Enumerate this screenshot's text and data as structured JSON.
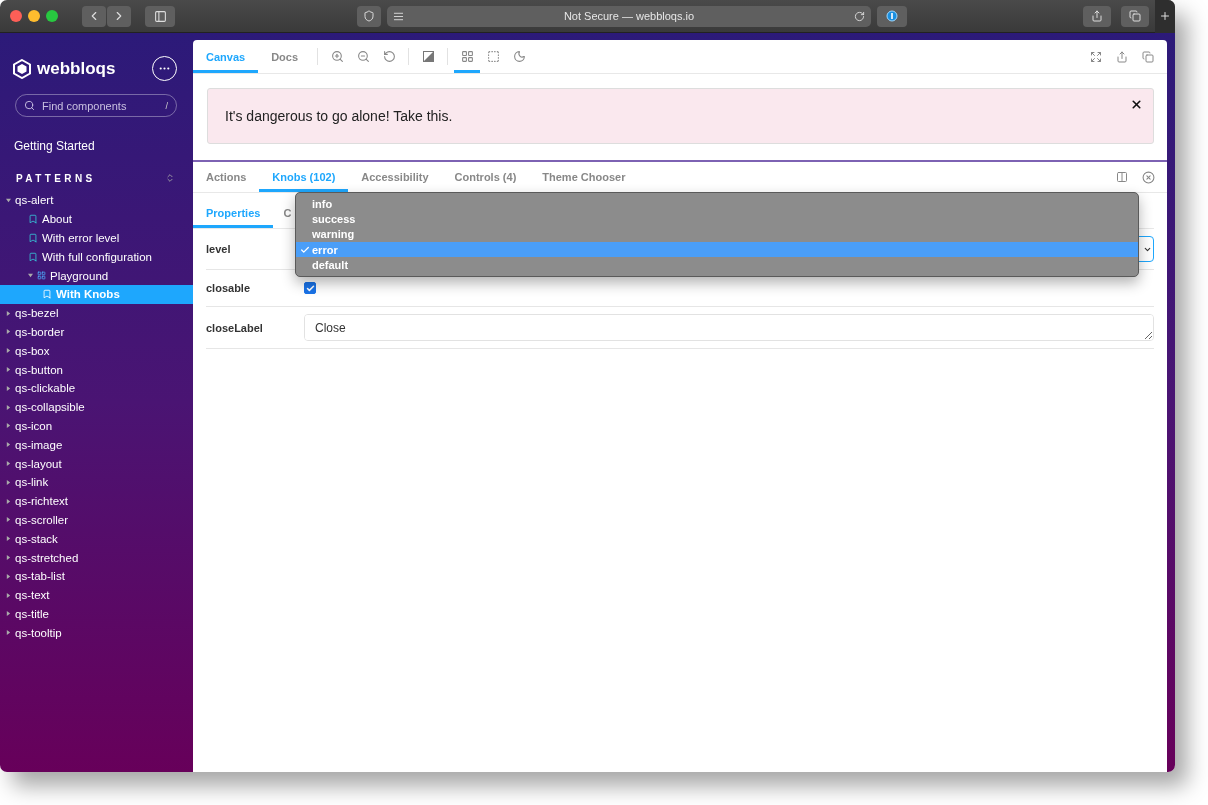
{
  "browser": {
    "address": "Not Secure — webbloqs.io"
  },
  "sidebar": {
    "logo": "webbloqs",
    "search": {
      "placeholder": "Find components",
      "shortcut": "/"
    },
    "links": [
      "Getting Started"
    ],
    "section": "PATTERNS",
    "tree": [
      {
        "label": "qs-alert",
        "kind": "component",
        "expanded": true,
        "selected": false,
        "children": [
          {
            "label": "About",
            "kind": "story",
            "selected": false
          },
          {
            "label": "With error level",
            "kind": "story",
            "selected": false
          },
          {
            "label": "With full configuration",
            "kind": "story",
            "selected": false
          },
          {
            "label": "Playground",
            "kind": "group",
            "expanded": true,
            "selected": false,
            "children": [
              {
                "label": "With Knobs",
                "kind": "story",
                "selected": true
              }
            ]
          }
        ]
      },
      {
        "label": "qs-bezel",
        "kind": "component",
        "expanded": false,
        "selected": false
      },
      {
        "label": "qs-border",
        "kind": "component",
        "expanded": false,
        "selected": false
      },
      {
        "label": "qs-box",
        "kind": "component",
        "expanded": false,
        "selected": false
      },
      {
        "label": "qs-button",
        "kind": "component",
        "expanded": false,
        "selected": false
      },
      {
        "label": "qs-clickable",
        "kind": "component",
        "expanded": false,
        "selected": false
      },
      {
        "label": "qs-collapsible",
        "kind": "component",
        "expanded": false,
        "selected": false
      },
      {
        "label": "qs-icon",
        "kind": "component",
        "expanded": false,
        "selected": false
      },
      {
        "label": "qs-image",
        "kind": "component",
        "expanded": false,
        "selected": false
      },
      {
        "label": "qs-layout",
        "kind": "component",
        "expanded": false,
        "selected": false
      },
      {
        "label": "qs-link",
        "kind": "component",
        "expanded": false,
        "selected": false
      },
      {
        "label": "qs-richtext",
        "kind": "component",
        "expanded": false,
        "selected": false
      },
      {
        "label": "qs-scroller",
        "kind": "component",
        "expanded": false,
        "selected": false
      },
      {
        "label": "qs-stack",
        "kind": "component",
        "expanded": false,
        "selected": false
      },
      {
        "label": "qs-stretched",
        "kind": "component",
        "expanded": false,
        "selected": false
      },
      {
        "label": "qs-tab-list",
        "kind": "component",
        "expanded": false,
        "selected": false
      },
      {
        "label": "qs-text",
        "kind": "component",
        "expanded": false,
        "selected": false
      },
      {
        "label": "qs-title",
        "kind": "component",
        "expanded": false,
        "selected": false
      },
      {
        "label": "qs-tooltip",
        "kind": "component",
        "expanded": false,
        "selected": false
      }
    ]
  },
  "toolbar": {
    "tabs": [
      {
        "label": "Canvas",
        "selected": true
      },
      {
        "label": "Docs",
        "selected": false
      }
    ],
    "tool_groups": [
      {
        "tools": [
          {
            "kind": "zoom-in",
            "selected": false
          },
          {
            "kind": "zoom-out",
            "selected": false
          },
          {
            "kind": "zoom-reset",
            "selected": false
          }
        ]
      },
      {
        "tools": [
          {
            "kind": "background",
            "selected": false
          }
        ]
      },
      {
        "tools": [
          {
            "kind": "grid",
            "selected": true
          },
          {
            "kind": "outline",
            "selected": false
          },
          {
            "kind": "theme",
            "selected": false
          }
        ]
      }
    ]
  },
  "alert": {
    "message": "It's dangerous to go alone! Take this.",
    "closable": true
  },
  "addons": {
    "tabs": [
      {
        "label": "Actions",
        "selected": false
      },
      {
        "label": "Knobs (102)",
        "selected": true
      },
      {
        "label": "Accessibility",
        "selected": false
      },
      {
        "label": "Controls (4)",
        "selected": false
      },
      {
        "label": "Theme Chooser",
        "selected": false
      }
    ],
    "subtabs": [
      {
        "label": "Properties",
        "selected": true
      },
      {
        "label": "C",
        "selected": false
      }
    ],
    "knobs": [
      {
        "name": "level",
        "kind": "select"
      },
      {
        "name": "closable",
        "kind": "checkbox",
        "checked": true
      },
      {
        "name": "closeLabel",
        "kind": "text",
        "value": "Close"
      }
    ]
  },
  "dropdown": {
    "options": [
      {
        "label": "info",
        "selected": false
      },
      {
        "label": "success",
        "selected": false
      },
      {
        "label": "warning",
        "selected": false
      },
      {
        "label": "error",
        "selected": true
      },
      {
        "label": "default",
        "selected": false
      }
    ]
  }
}
